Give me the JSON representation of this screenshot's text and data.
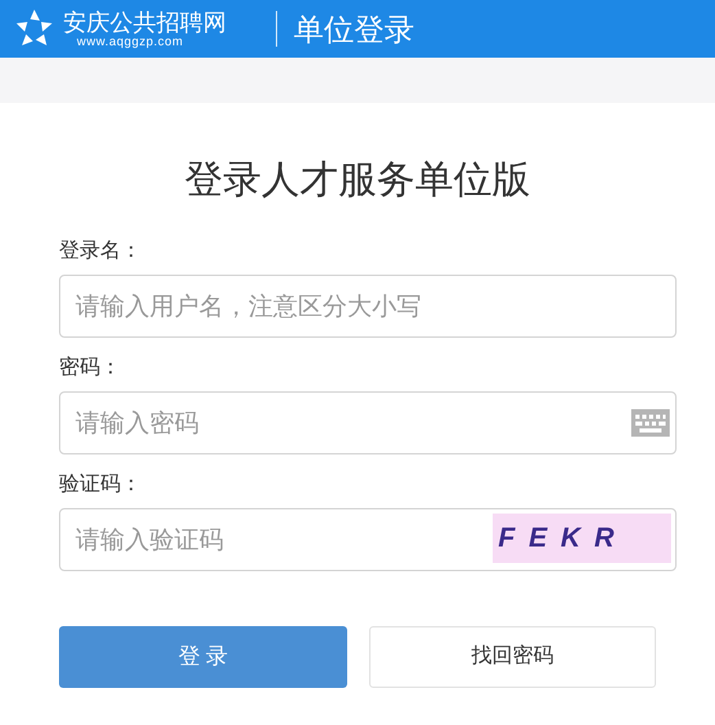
{
  "header": {
    "site_name": "安庆公共招聘网",
    "site_url": "www.aqggzp.com",
    "section_title": "单位登录"
  },
  "title": "登录人才服务单位版",
  "fields": [
    {
      "kind": "text",
      "label": "登录名：",
      "placeholder": "请输入用户名，注意区分大小写"
    },
    {
      "kind": "password",
      "label": "密码：",
      "placeholder": "请输入密码"
    },
    {
      "kind": "captcha",
      "label": "验证码：",
      "placeholder": "请输入验证码",
      "captcha_text": "FEKR"
    }
  ],
  "buttons": [
    {
      "kind": "primary",
      "label": "登 录"
    },
    {
      "kind": "secondary",
      "label": "找回密码"
    }
  ]
}
